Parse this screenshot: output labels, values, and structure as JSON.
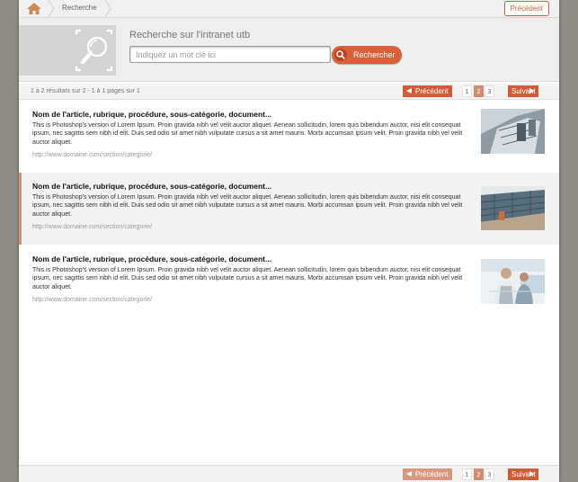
{
  "breadcrumb": {
    "home_icon": "home-icon",
    "current": "Recherche",
    "top_prev_label": "Précédent"
  },
  "search": {
    "title": "Recherche sur l'intranet utb",
    "placeholder": "Indiquez un mot clé ici",
    "value": "",
    "button_label": "Rechercher",
    "logo_icon": "magnifier-icon",
    "button_icon": "search-icon"
  },
  "pagination": {
    "summary": "1 à 2 résultats sur 2 - 1 à 1 pages sur 1",
    "prev_label": "Précédent",
    "next_label": "Suivant",
    "pages": [
      "1",
      "2",
      "3"
    ],
    "active_page": "2"
  },
  "results": [
    {
      "title": "Nom de l'article, rubrique, procédure, sous-catégorie, document...",
      "description": "This is Photoshop's version  of Lorem Ipsum. Proin gravida nibh vel velit auctor aliquet. Aenean sollicitudin, lorem quis bibendum auctor, nisi elit consequat ipsum, nec sagittis sem nibh id elit. Duis sed odio sit amet nibh vulputate cursus a sit amet mauris. Morbi accumsan ipsum velit. Proin gravida nibh vel velit auctor aliquet.",
      "url": "http://www.domaine.com/section/categorie/",
      "thumbnail": "building-photo"
    },
    {
      "title": "Nom de l'article, rubrique, procédure, sous-catégorie, document...",
      "description": "This is Photoshop's version  of Lorem Ipsum. Proin gravida nibh vel velit auctor aliquet. Aenean sollicitudin, lorem quis bibendum auctor, nisi elit consequat ipsum, nec sagittis sem nibh id elit. Duis sed odio sit amet nibh vulputate cursus a sit amet mauris. Morbi accumsan ipsum velit. Proin gravida nibh vel velit auctor aliquet.",
      "url": "http://www.domaine.com/section/categorie/",
      "thumbnail": "roof-photo"
    },
    {
      "title": "Nom de l'article, rubrique, procédure, sous-catégorie, document...",
      "description": "This is Photoshop's version  of Lorem Ipsum. Proin gravida nibh vel velit auctor aliquet. Aenean sollicitudin, lorem quis bibendum auctor, nisi elit consequat ipsum, nec sagittis sem nibh id elit. Duis sed odio sit amet nibh vulputate cursus a sit amet mauris. Morbi accumsan ipsum velit. Proin gravida nibh vel velit auctor aliquet.",
      "url": "http://www.domaine.com/section/categorie/",
      "thumbnail": "people-photo"
    }
  ],
  "colors": {
    "accent": "#d9603a",
    "highlight_bar": "#c9966f"
  }
}
